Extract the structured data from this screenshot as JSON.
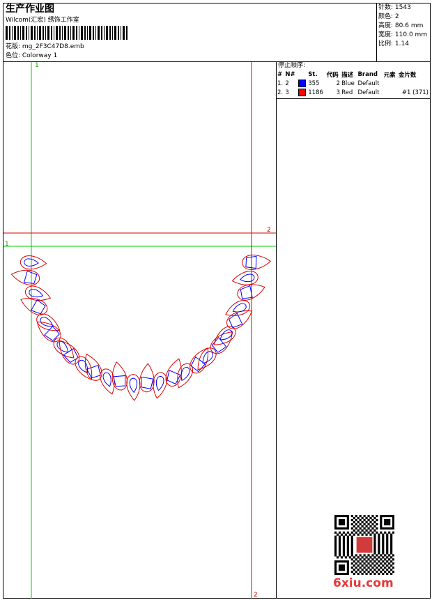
{
  "header": {
    "title": "生产作业图",
    "subtitle": "Wilcom(汇宏) 绣饰工作室",
    "design": "花版:  mg_2F3C47D8.emb",
    "colorway": "色位:  Colorway 1"
  },
  "info": [
    {
      "label": "针数:",
      "value": "1543"
    },
    {
      "label": "颜色:",
      "value": "2"
    },
    {
      "label": "高度:",
      "value": "80.6 mm"
    },
    {
      "label": "宽度:",
      "value": "110.0 mm"
    },
    {
      "label": "比例:",
      "value": "1.14"
    }
  ],
  "stop_sequence": {
    "title": "停止顺序:",
    "columns": [
      "#",
      "N#",
      "St.",
      "代码",
      "描述",
      "Brand",
      "元素",
      "金片数"
    ],
    "rows": [
      {
        "idx": "1.",
        "needle": "2",
        "color": "#0000ff",
        "stitches": "355",
        "code": "2",
        "desc": "Blue",
        "brand": "Default",
        "element": "",
        "sequins": ""
      },
      {
        "idx": "2.",
        "needle": "3",
        "color": "#ff0000",
        "stitches": "1186",
        "code": "3",
        "desc": "Red",
        "brand": "Default",
        "element": "",
        "sequins": "#1 (371)"
      }
    ]
  },
  "guides": {
    "green_label": "1",
    "red_label": "2",
    "green_color": "#00cc00",
    "red_color": "#dd0000"
  },
  "watermark": {
    "site": "6xiu.com"
  }
}
